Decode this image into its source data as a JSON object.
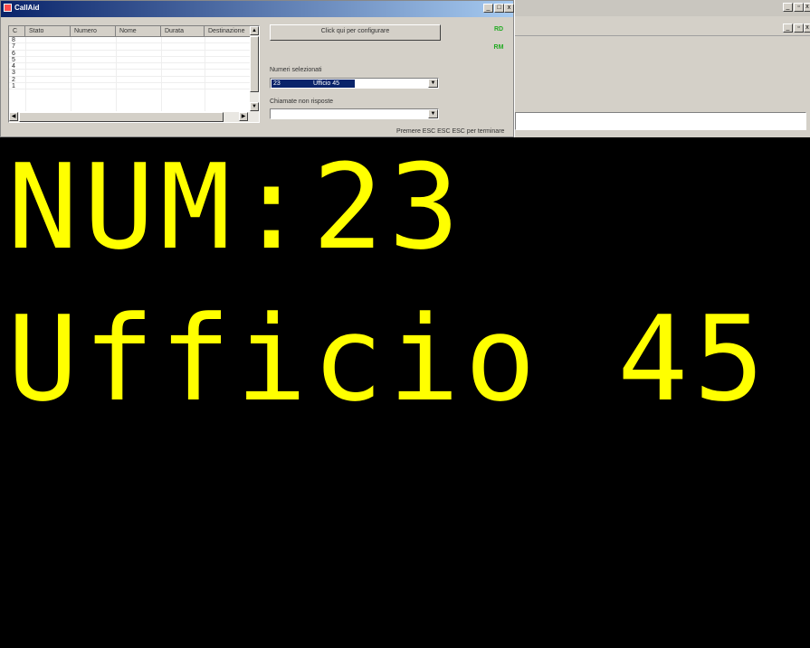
{
  "window": {
    "title": "CallAid",
    "controls": [
      "_",
      "□",
      "x"
    ]
  },
  "list": {
    "columns": [
      "C",
      "Stato",
      "Numero",
      "Nome",
      "Durata",
      "Destinazione"
    ],
    "rows": [
      "8",
      "7",
      "6",
      "5",
      "4",
      "3",
      "2",
      "1"
    ]
  },
  "config_button": "Click qui per configurare",
  "indicators": [
    {
      "label": "RD",
      "color": "#22aa22"
    },
    {
      "label": "RM",
      "color": "#22aa22"
    }
  ],
  "numeri": {
    "label": "Numeri selezionati",
    "value_num": "23",
    "value_name": "Ufficio 45"
  },
  "chiamate": {
    "label": "Chiamate non risposte",
    "value": ""
  },
  "footer_hint": "Premere ESC ESC ESC per terminare",
  "display": {
    "line1": "NUM:23",
    "line2": "Ufficio 45",
    "color": "#ffff00"
  }
}
